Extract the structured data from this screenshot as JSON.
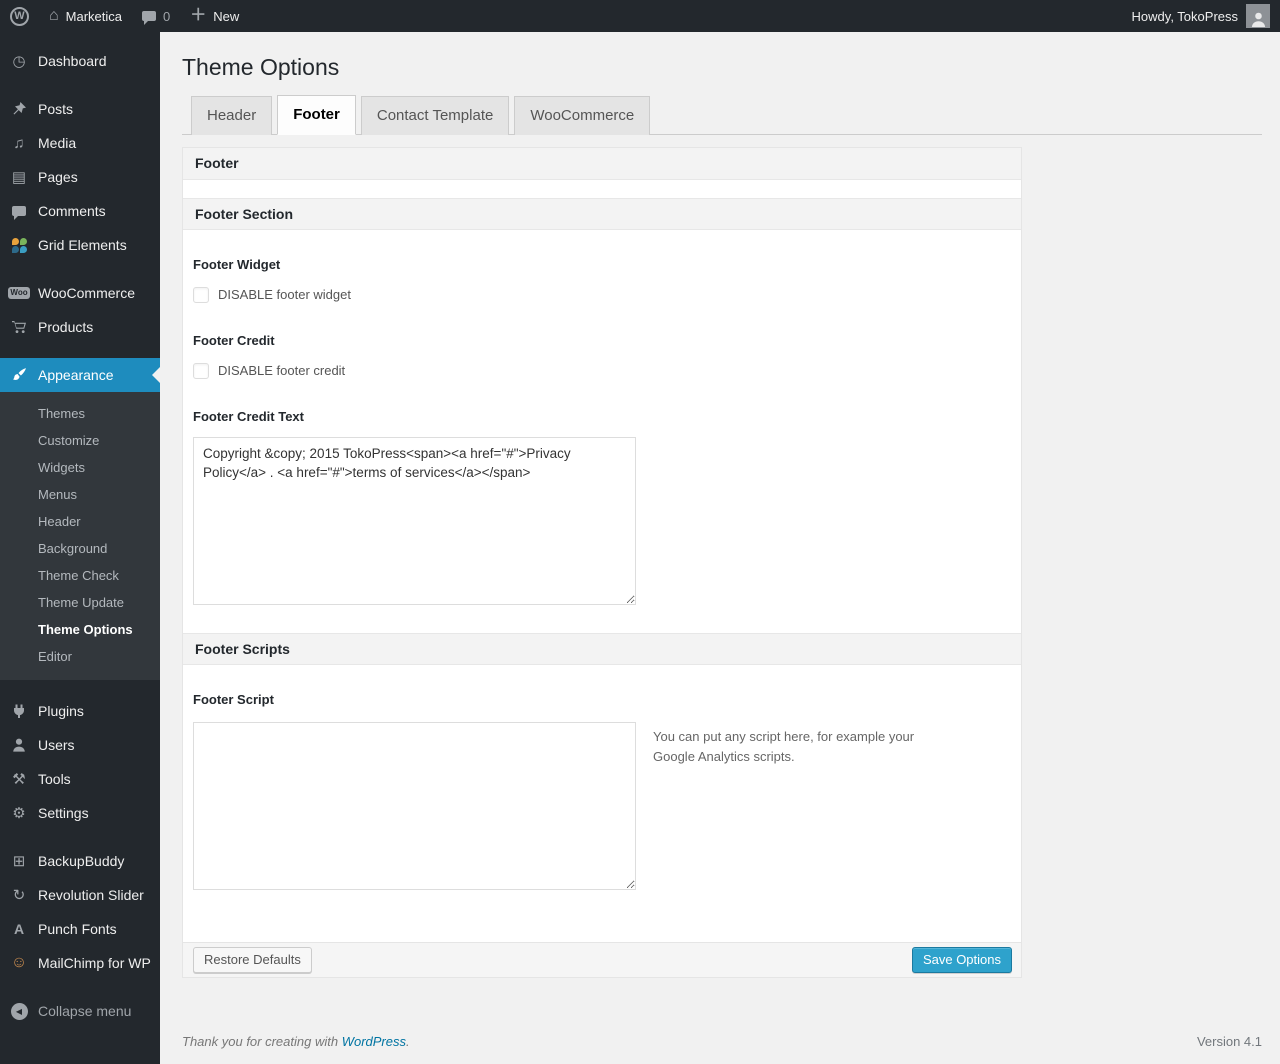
{
  "colors": {
    "accent_blue": "#2ea2cc",
    "menu_highlight": "#1e8cbe",
    "link_blue": "#0074a2"
  },
  "admin_bar": {
    "wp_logo_letter": "W",
    "site_name": "Marketica",
    "comment_count": "0",
    "new_label": "New",
    "howdy_text": "Howdy, TokoPress"
  },
  "sidebar": {
    "dashboard": {
      "label": "Dashboard",
      "glyph": "◷"
    },
    "posts": {
      "label": "Posts"
    },
    "media": {
      "label": "Media",
      "glyph": "♫"
    },
    "pages": {
      "label": "Pages",
      "glyph": "▤"
    },
    "comments": {
      "label": "Comments"
    },
    "grid_elements": {
      "label": "Grid Elements"
    },
    "woocommerce": {
      "label": "WooCommerce",
      "badge": "Woo"
    },
    "products": {
      "label": "Products"
    },
    "appearance": {
      "label": "Appearance"
    },
    "appearance_submenu": [
      {
        "label": "Themes"
      },
      {
        "label": "Customize"
      },
      {
        "label": "Widgets"
      },
      {
        "label": "Menus"
      },
      {
        "label": "Header"
      },
      {
        "label": "Background"
      },
      {
        "label": "Theme Check"
      },
      {
        "label": "Theme Update"
      },
      {
        "label": "Theme Options"
      },
      {
        "label": "Editor"
      }
    ],
    "plugins": {
      "label": "Plugins"
    },
    "users": {
      "label": "Users"
    },
    "tools": {
      "label": "Tools",
      "glyph": "⚒"
    },
    "settings": {
      "label": "Settings",
      "glyph": "⚙"
    },
    "backupbuddy": {
      "label": "BackupBuddy",
      "glyph": "⊞"
    },
    "revolution_slider": {
      "label": "Revolution Slider",
      "glyph": "↻"
    },
    "punch_fonts": {
      "label": "Punch Fonts",
      "glyph": "A"
    },
    "mailchimp": {
      "label": "MailChimp for WP",
      "glyph": "☺"
    },
    "collapse": {
      "label": "Collapse menu",
      "glyph": "◀"
    }
  },
  "main": {
    "title": "Theme Options",
    "tabs": [
      {
        "label": "Header"
      },
      {
        "label": "Footer"
      },
      {
        "label": "Contact Template"
      },
      {
        "label": "WooCommerce"
      }
    ]
  },
  "panel": {
    "box_title": "Footer",
    "section1": {
      "title": "Footer Section",
      "footer_widget_label": "Footer Widget",
      "footer_widget_checkbox": "DISABLE footer widget",
      "footer_credit_label": "Footer Credit",
      "footer_credit_checkbox": "DISABLE footer credit",
      "footer_credit_text_label": "Footer Credit Text",
      "footer_credit_text_value": "Copyright &copy; 2015 TokoPress<span><a href=\"#\">Privacy Policy</a> . <a href=\"#\">terms of services</a></span>"
    },
    "section2": {
      "title": "Footer Scripts",
      "footer_script_label": "Footer Script",
      "footer_script_value": "",
      "footer_script_desc": "You can put any script here, for example your Google Analytics scripts."
    },
    "footer_actions": {
      "restore_label": "Restore Defaults",
      "save_label": "Save Options"
    }
  },
  "page_footer": {
    "thanks_prefix": "Thank you for creating with ",
    "thanks_link": "WordPress",
    "thanks_suffix": ".",
    "version": "Version 4.1"
  }
}
